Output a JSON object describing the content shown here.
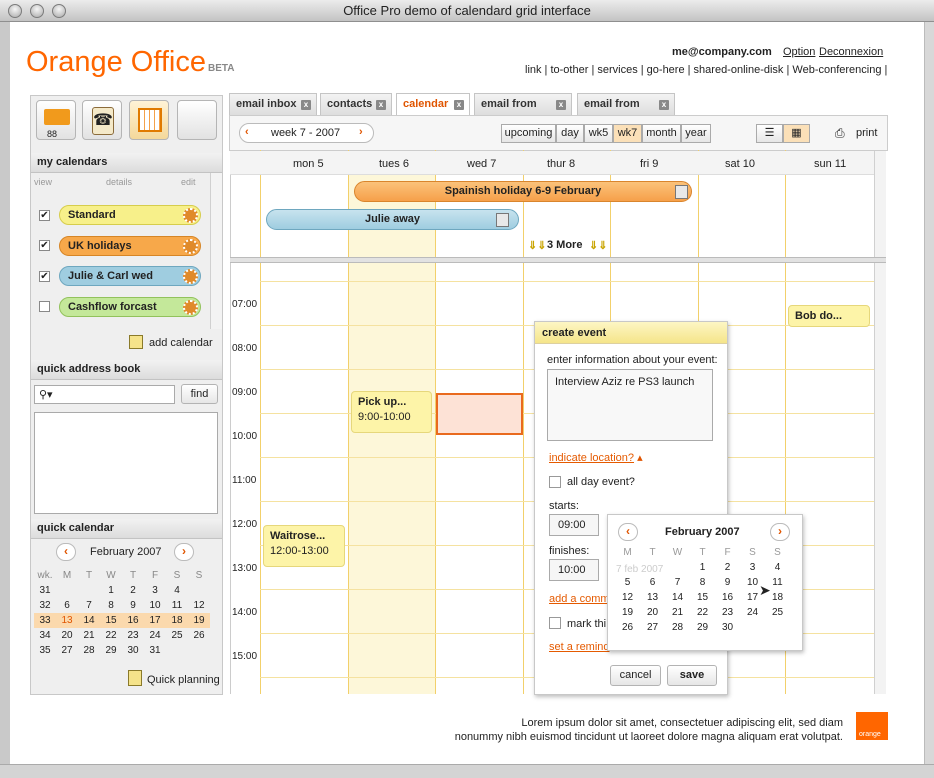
{
  "window": {
    "title": "Office Pro demo of calendard grid interface"
  },
  "brand": {
    "name": "Orange Office",
    "badge": "BETA",
    "accent": "#ff6600"
  },
  "account": {
    "email": "me@company.com",
    "option": "Option",
    "logout": "Deconnexion"
  },
  "toplinks": "link | to-other | services | go-here | shared-online-disk | Web-conferencing |",
  "apps": {
    "mail_count": "88"
  },
  "my_calendars": {
    "title": "my calendars",
    "col_view": "view",
    "col_details": "details",
    "col_edit": "edit",
    "items": [
      {
        "label": "Standard",
        "checked": "✔",
        "color": "#f7f08a"
      },
      {
        "label": "UK holidays",
        "checked": "✔",
        "color": "#f7a84a"
      },
      {
        "label": "Julie & Carl wed",
        "checked": "✔",
        "color": "#9fcde0"
      },
      {
        "label": "Cashflow forcast",
        "checked": "",
        "color": "#c4e89a"
      }
    ],
    "add": "add calendar"
  },
  "address_book": {
    "title": "quick address book",
    "find": "find"
  },
  "quick_calendar": {
    "title": "quick calendar",
    "month": "February 2007",
    "head": [
      "wk.",
      "M",
      "T",
      "W",
      "T",
      "F",
      "S",
      "S"
    ],
    "rows": [
      [
        "31",
        "",
        "",
        "1",
        "2",
        "3",
        "4",
        ""
      ],
      [
        "32",
        "6",
        "7",
        "8",
        "9",
        "10",
        "11",
        "12"
      ],
      [
        "33",
        "13",
        "14",
        "15",
        "16",
        "17",
        "18",
        "19"
      ],
      [
        "34",
        "20",
        "21",
        "22",
        "23",
        "24",
        "25",
        "26"
      ],
      [
        "35",
        "27",
        "28",
        "29",
        "30",
        "31",
        "",
        ""
      ]
    ],
    "planning": "Quick planning"
  },
  "tabs": [
    {
      "label": "email inbox"
    },
    {
      "label": "contacts"
    },
    {
      "label": "calendar"
    },
    {
      "label": "email from"
    },
    {
      "label": "email from"
    }
  ],
  "toolbar": {
    "week": "week 7 - 2007",
    "views": [
      "upcoming",
      "day",
      "wk5",
      "wk7",
      "month",
      "year"
    ],
    "print": "print"
  },
  "days": [
    "mon 5",
    "tues 6",
    "wed 7",
    "thur 8",
    "fri 9",
    "sat 10",
    "sun 11"
  ],
  "allday": {
    "holiday": "Spainish holiday 6-9 February",
    "away": "Julie away",
    "more": "3 More"
  },
  "hours": [
    "07:00",
    "08:00",
    "09:00",
    "10:00",
    "11:00",
    "12:00",
    "13:00",
    "14:00",
    "15:00"
  ],
  "events": {
    "pickup_title": "Pick up...",
    "pickup_time": "9:00-10:00",
    "waitrose_title": "Waitrose...",
    "waitrose_time": "12:00-13:00",
    "bob": "Bob do..."
  },
  "create_event": {
    "title": "create event",
    "prompt": "enter information about your event:",
    "text": "Interview Aziz re PS3 launch",
    "location": "indicate location?",
    "allday": "all day event?",
    "starts": "starts:",
    "start_time": "09:00",
    "finishes": "finishes:",
    "end_time": "10:00",
    "comment": "add a comm",
    "mark": "mark thi",
    "reminder": "set a remind",
    "cancel": "cancel",
    "save": "save"
  },
  "datepicker": {
    "month": "February 2007",
    "ghost": "7 feb 2007",
    "head": [
      "M",
      "T",
      "W",
      "T",
      "F",
      "S",
      "S"
    ],
    "rows": [
      [
        "",
        "",
        "",
        "1",
        "2",
        "3",
        "4"
      ],
      [
        "5",
        "6",
        "7",
        "8",
        "9",
        "10",
        "11"
      ],
      [
        "12",
        "13",
        "14",
        "15",
        "16",
        "17",
        "18"
      ],
      [
        "19",
        "20",
        "21",
        "22",
        "23",
        "24",
        "25"
      ],
      [
        "26",
        "27",
        "28",
        "29",
        "30",
        "",
        ""
      ]
    ]
  },
  "footer": {
    "line1": "Lorem ipsum dolor sit amet, consectetuer adipiscing elit, sed diam",
    "line2": "nonummy nibh euismod tincidunt ut laoreet dolore magna aliquam erat volutpat.",
    "logo": "orange"
  }
}
